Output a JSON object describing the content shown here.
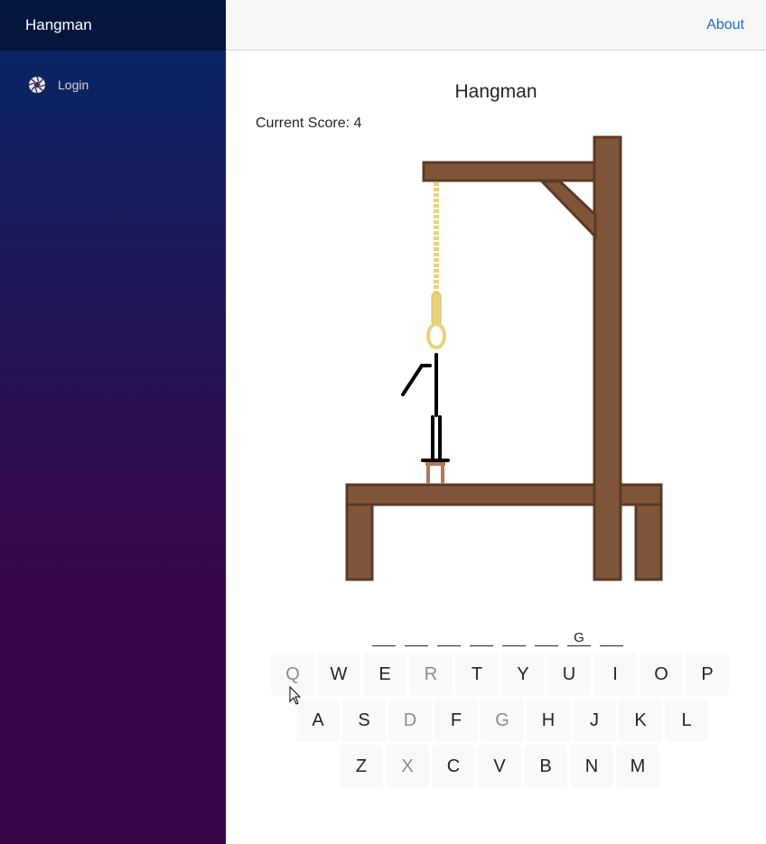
{
  "sidebar": {
    "brand": "Hangman",
    "nav": [
      {
        "label": "Login",
        "icon": "aperture-icon"
      }
    ]
  },
  "topbar": {
    "about_label": "About"
  },
  "game": {
    "title": "Hangman",
    "score_text": "Current Score: 4",
    "word_slots": [
      "",
      "",
      "",
      "",
      "",
      "",
      "G",
      ""
    ]
  },
  "keyboard": {
    "rows": [
      [
        {
          "letter": "Q",
          "used": true
        },
        {
          "letter": "W",
          "used": false
        },
        {
          "letter": "E",
          "used": false
        },
        {
          "letter": "R",
          "used": true
        },
        {
          "letter": "T",
          "used": false
        },
        {
          "letter": "Y",
          "used": false
        },
        {
          "letter": "U",
          "used": false
        },
        {
          "letter": "I",
          "used": false
        },
        {
          "letter": "O",
          "used": false
        },
        {
          "letter": "P",
          "used": false
        }
      ],
      [
        {
          "letter": "A",
          "used": false
        },
        {
          "letter": "S",
          "used": false
        },
        {
          "letter": "D",
          "used": true
        },
        {
          "letter": "F",
          "used": false
        },
        {
          "letter": "G",
          "used": true
        },
        {
          "letter": "H",
          "used": false
        },
        {
          "letter": "J",
          "used": false
        },
        {
          "letter": "K",
          "used": false
        },
        {
          "letter": "L",
          "used": false
        }
      ],
      [
        {
          "letter": "Z",
          "used": false
        },
        {
          "letter": "X",
          "used": true
        },
        {
          "letter": "C",
          "used": false
        },
        {
          "letter": "V",
          "used": false
        },
        {
          "letter": "B",
          "used": false
        },
        {
          "letter": "N",
          "used": false
        },
        {
          "letter": "M",
          "used": false
        }
      ]
    ]
  },
  "colors": {
    "wood": "#7f5539",
    "wood_edge": "#5a3a26",
    "rope": "#e8d27a",
    "figure": "#000000",
    "link": "#1b6ec2"
  }
}
